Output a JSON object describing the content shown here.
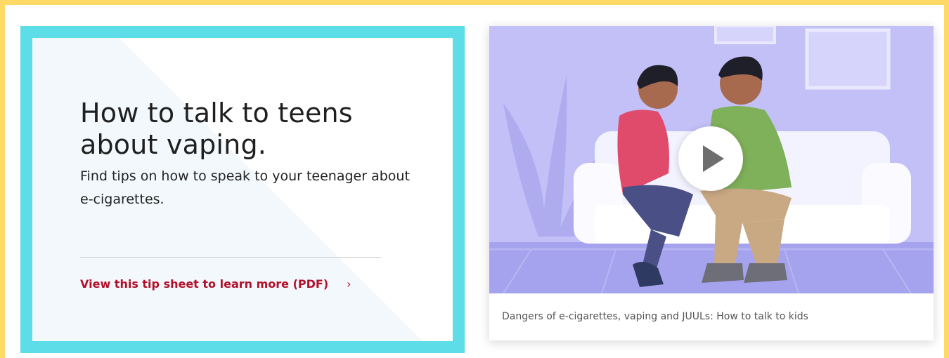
{
  "promo": {
    "headline": "How to talk to teens about vaping.",
    "subhead": "Find tips on how to speak to your teenager about e-cigarettes.",
    "cta_label": "View this tip sheet to learn more (PDF)",
    "cta_chevron": "›"
  },
  "video": {
    "caption": "Dangers of e-cigarettes, vaping and JUULs: How to talk to kids",
    "play_icon": "play-icon"
  },
  "colors": {
    "page_border": "#ffd966",
    "card_border": "#5cdde8",
    "link": "#b0102a",
    "video_bg": "#bfbdf6"
  }
}
